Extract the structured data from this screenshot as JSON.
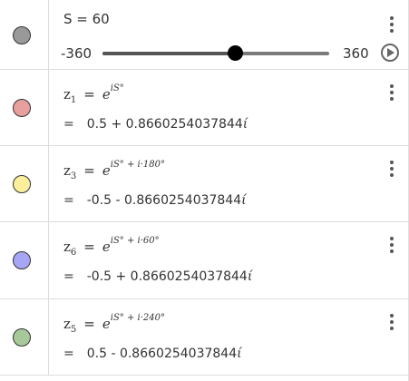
{
  "slider": {
    "name": "S",
    "value": 60,
    "label": "S = 60",
    "min_label": "-360",
    "max_label": "360",
    "min": -360,
    "max": 360,
    "marble_color": "#999999",
    "menu_icon": "more-vert-icon",
    "play_icon": "play-icon"
  },
  "rows": [
    {
      "name": "z",
      "sub": "1",
      "eq": "=",
      "base": "e",
      "exponent": "iS°",
      "value_eq": "=",
      "value": "0.5 + 0.8660254037844",
      "imag_unit": "ί",
      "marble_color": "#e8a09e"
    },
    {
      "name": "z",
      "sub": "3",
      "eq": "=",
      "base": "e",
      "exponent": "iS° + i·180°",
      "value_eq": "=",
      "value": "-0.5 - 0.8660254037844",
      "imag_unit": "ί",
      "marble_color": "#fbef9c"
    },
    {
      "name": "z",
      "sub": "6",
      "eq": "=",
      "base": "e",
      "exponent": "iS° + i·60°",
      "value_eq": "=",
      "value": "-0.5 + 0.8660254037844",
      "imag_unit": "ί",
      "marble_color": "#a6a6f4"
    },
    {
      "name": "z",
      "sub": "5",
      "eq": "=",
      "base": "e",
      "exponent": "iS° + i·240°",
      "value_eq": "=",
      "value": "0.5 - 0.8660254037844",
      "imag_unit": "ί",
      "marble_color": "#a7c99a"
    }
  ]
}
